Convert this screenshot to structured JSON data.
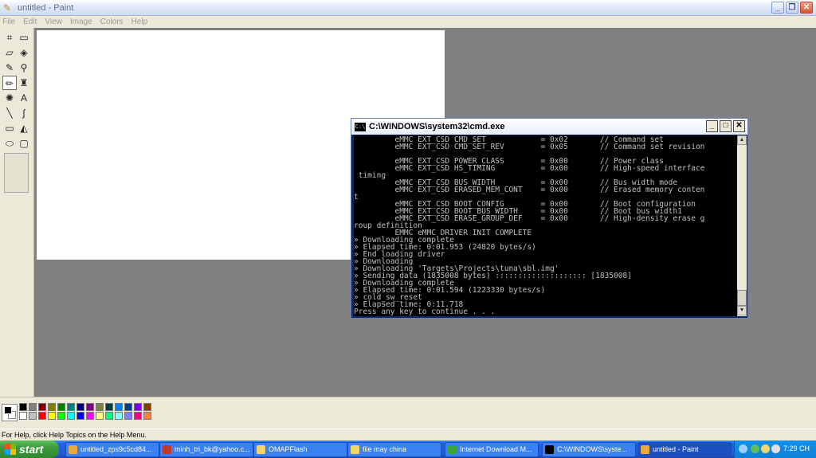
{
  "paint": {
    "title": "untitled - Paint",
    "menu": [
      "File",
      "Edit",
      "View",
      "Image",
      "Colors",
      "Help"
    ],
    "status": "For Help, click Help Topics on the Help Menu.",
    "window_buttons": [
      "_",
      "❐",
      "✕"
    ],
    "tools": [
      {
        "name": "free-form-select-icon",
        "glyph": "⌗"
      },
      {
        "name": "select-icon",
        "glyph": "▭"
      },
      {
        "name": "eraser-icon",
        "glyph": "▱"
      },
      {
        "name": "fill-icon",
        "glyph": "◈"
      },
      {
        "name": "pick-color-icon",
        "glyph": "✎"
      },
      {
        "name": "magnifier-icon",
        "glyph": "⚲"
      },
      {
        "name": "pencil-icon",
        "glyph": "✏"
      },
      {
        "name": "brush-icon",
        "glyph": "♜"
      },
      {
        "name": "airbrush-icon",
        "glyph": "✺"
      },
      {
        "name": "text-icon",
        "glyph": "A"
      },
      {
        "name": "line-icon",
        "glyph": "╲"
      },
      {
        "name": "curve-icon",
        "glyph": "∫"
      },
      {
        "name": "rectangle-icon",
        "glyph": "▭"
      },
      {
        "name": "polygon-icon",
        "glyph": "◭"
      },
      {
        "name": "ellipse-icon",
        "glyph": "⬭"
      },
      {
        "name": "rounded-rectangle-icon",
        "glyph": "▢"
      }
    ],
    "palette_row1": [
      "#000000",
      "#808080",
      "#800000",
      "#808000",
      "#008000",
      "#008080",
      "#000080",
      "#800080",
      "#808040",
      "#004040",
      "#0080ff",
      "#004080",
      "#8000ff",
      "#804000"
    ],
    "palette_row2": [
      "#ffffff",
      "#c0c0c0",
      "#ff0000",
      "#ffff00",
      "#00ff00",
      "#00ffff",
      "#0000ff",
      "#ff00ff",
      "#ffff80",
      "#00ff80",
      "#80ffff",
      "#8080ff",
      "#ff0080",
      "#ff8040"
    ]
  },
  "cmd": {
    "title": "C:\\WINDOWS\\system32\\cmd.exe",
    "buttons": [
      "_",
      "□",
      "✕"
    ],
    "lines": [
      "         eMMC EXT_CSD CMD_SET            = 0x02       // Command set",
      "         eMMC EXT_CSD CMD_SET_REV        = 0x05       // Command set revision",
      "",
      "         eMMC EXT_CSD POWER_CLASS        = 0x00       // Power class",
      "         eMMC EXT_CSD HS_TIMING          = 0x00       // High-speed interface",
      " timing",
      "         eMMC EXT_CSD BUS_WIDTH          = 0x00       // Bus width mode",
      "         eMMC EXT_CSD ERASED_MEM_CONT    = 0x00       // Erased memory conten",
      "t",
      "         eMMC EXT_CSD BOOT_CONFIG        = 0x00       // Boot configuration",
      "         eMMC EXT_CSD BOOT_BUS_WIDTH     = 0x00       // Boot bus width1",
      "         eMMC EXT_CSD ERASE_GROUP_DEF    = 0x00       // High-density erase g",
      "roup definition",
      "         EMMC eMMC DRIVER INIT COMPLETE",
      "» Downloading complete",
      "» Elapsed time: 0:01.953 (24820 bytes/s)",
      "» End loading driver",
      "» Downloading",
      "» Downloading 'Targets\\Projects\\tuna\\sbl.img'",
      "» Sending data (1835008 bytes) :::::::::::::::::::: [1835008]",
      "» Downloading complete",
      "» Elapsed time: 0:01.594 (1223330 bytes/s)",
      "» cold_sw_reset",
      "» Elapsed time: 0:11.718",
      "Press any key to continue . . ."
    ]
  },
  "taskbar": {
    "start_label": "start",
    "items": [
      {
        "label": "untitled_zps9c5cd84...",
        "color": "#e8a93c"
      },
      {
        "label": "minh_tri_bk@yahoo.c...",
        "color": "#c0392b"
      },
      {
        "label": "OMAPFlash",
        "color": "#f3d36b"
      },
      {
        "label": "file may china",
        "color": "#f3d36b"
      },
      {
        "label": "Internet Download M...",
        "color": "#3aa63a"
      },
      {
        "label": "C:\\WINDOWS\\syste...",
        "color": "#000000"
      },
      {
        "label": "untitled - Paint",
        "color": "#e8a93c"
      }
    ],
    "clock": "7:29 CH"
  }
}
